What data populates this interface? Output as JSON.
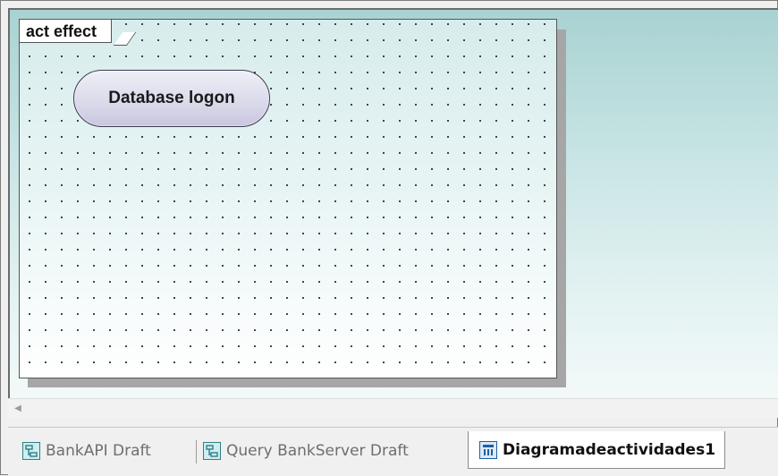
{
  "diagram": {
    "frame_label": "act effect",
    "action_label": "Database logon"
  },
  "tabs": [
    {
      "label": "BankAPI Draft",
      "icon": "class-diagram-icon",
      "active": false
    },
    {
      "label": "Query BankServer Draft",
      "icon": "class-diagram-icon",
      "active": false
    },
    {
      "label": "Diagramadeactividades1",
      "icon": "activity-diagram-icon",
      "active": true
    }
  ],
  "colors": {
    "canvas_top": "#a9d2d2",
    "action_fill": "#d9d9ea",
    "icon_teal": "#2f7f86"
  }
}
